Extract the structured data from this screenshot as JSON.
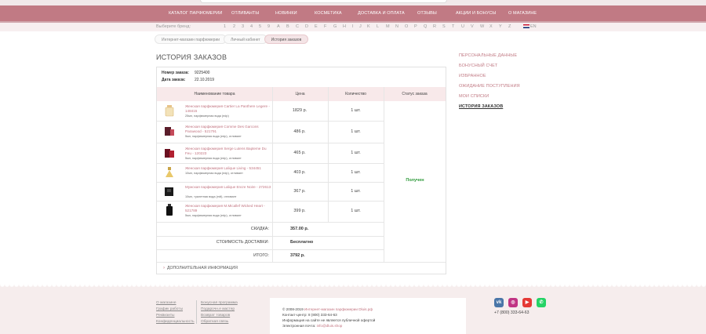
{
  "nav": {
    "items": [
      "КАТАЛОГ ПАРФЮМЕРИИ",
      "ОТЛИВАНТЫ",
      "НОВИНКИ",
      "КОСМЕТИКА",
      "ДОСТАВКА И ОПЛАТА",
      "ОТЗЫВЫ",
      "АКЦИИ И БОНУСЫ",
      "О МАГАЗИНЕ"
    ]
  },
  "brand_filter": {
    "label": "Выберите бренд:",
    "letters": [
      "1",
      "2",
      "3",
      "4",
      "5",
      "9",
      "A",
      "B",
      "C",
      "D",
      "E",
      "F",
      "G",
      "H",
      "I",
      "J",
      "K",
      "L",
      "M",
      "N",
      "O",
      "P",
      "Q",
      "R",
      "S",
      "T",
      "U",
      "V",
      "W",
      "X",
      "Y",
      "Z"
    ],
    "lang": "EN"
  },
  "breadcrumb": [
    "Интернет-магазин парфюмерии",
    "Личный кабинет",
    "История заказов"
  ],
  "page_title": "ИСТОРИЯ ЗАКАЗОВ",
  "order": {
    "number_label": "Номер заказа:",
    "number": "9225400",
    "date_label": "Дата заказа:",
    "date": "22.10.2019",
    "columns": [
      "Наименование товара",
      "Цена",
      "Количество",
      "Статус заказа"
    ],
    "items": [
      {
        "name": "Женская парфюмерия Cartier La Panthere Legere - 148415",
        "desc": "25мл, парфюмерная вода (edp)",
        "price": "1829 р.",
        "qty": "1 шт."
      },
      {
        "name": "Женская парфюмерия Comme Des Garcons Parawood - 521791",
        "desc": "5мл, парфюмерная вода (edp), отливант",
        "price": "486 р.",
        "qty": "1 шт."
      },
      {
        "name": "Женская парфюмерия Serge Lutens Bapteme Du Feu - 120223",
        "desc": "5мл, парфюмерная вода (edp), отливант",
        "price": "465 р.",
        "qty": "1 шт."
      },
      {
        "name": "Женская парфюмерия Lalique Living - 534451",
        "desc": "10мл, парфюмерная вода (edp), отливант",
        "price": "403 р.",
        "qty": "1 шт."
      },
      {
        "name": "Мужская парфюмерия Lalique Encre Noire - 272613",
        "desc": "10мл, туалетная вода (edt), отливант",
        "price": "367 р.",
        "qty": "1 шт."
      },
      {
        "name": "Женская парфюмерия M.Micallef Wicked Heart - 521789",
        "desc": "5мл, парфюмерная вода (edp), отливант",
        "price": "399 р.",
        "qty": "1 шт."
      }
    ],
    "status": "Получен",
    "summary": [
      {
        "label": "СКИДКА:",
        "value": "357.00 р."
      },
      {
        "label": "СТОИМОСТЬ ДОСТАВКИ:",
        "value": "Бесплатно"
      },
      {
        "label": "ИТОГО:",
        "value": "3792 р."
      }
    ],
    "more_info": "ДОПОЛНИТЕЛЬНАЯ ИНФОРМАЦИЯ"
  },
  "sidebar": {
    "items": [
      "ПЕРСОНАЛЬНЫЕ ДАННЫЕ",
      "БОНУСНЫЙ СЧЕТ",
      "ИЗБРАННОЕ",
      "ОЖИДАНИЕ ПОСТУПЛЕНИЯ",
      "МОИ СПИСКИ",
      "ИСТОРИЯ ЗАКАЗОВ"
    ]
  },
  "footer": {
    "col1": [
      "О магазине",
      "График работы",
      "Реквизиты",
      "Конфиденциальность"
    ],
    "col2": [
      "Бонусная программа",
      "Подарочн.е мастер",
      "Возврат товаров",
      "Обратная связь"
    ],
    "copyright_prefix": "© 2008-2019",
    "copyright_link": "Интернет-магазин парфюмерии Dluis.рф",
    "contact": "Контакт-центр: 8 (800) 333-64-63",
    "disclaimer": "Информация на сайте не является публичной офертой",
    "email_label": "Электронная почта:",
    "email": "info@dluis.shop",
    "phone": "+7 (800) 333-64-63"
  },
  "colors": {
    "nav": "#c17a84",
    "accent_link": "#c27480",
    "status_ok": "#2e9a3a",
    "footer_bg": "#f6eded",
    "vk": "#4a76a8",
    "instagram": "#c13584",
    "youtube": "#e53935",
    "whatsapp": "#25d366"
  },
  "icons": [
    "vk-icon",
    "instagram-icon",
    "youtube-icon",
    "whatsapp-icon"
  ]
}
